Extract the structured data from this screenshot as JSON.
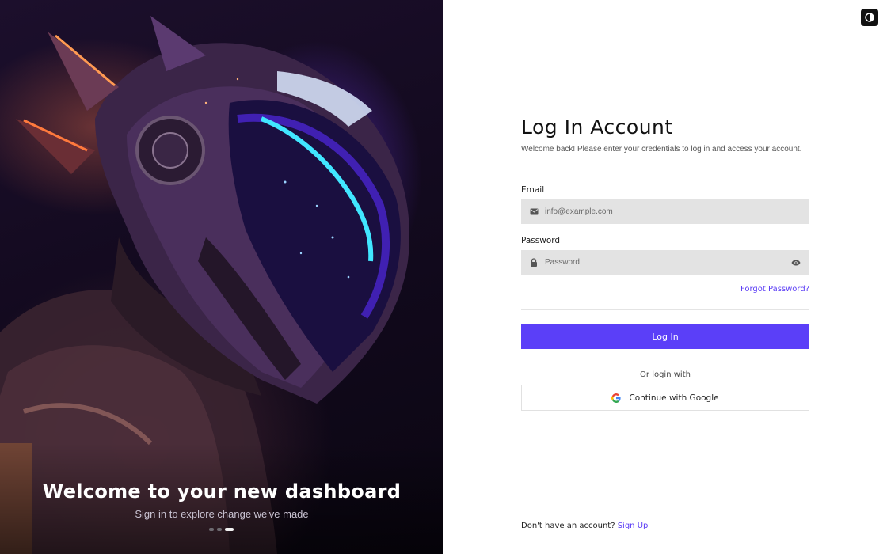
{
  "hero": {
    "image_alt": "Futuristic armored rider in a neon purple helmet",
    "title": "Welcome to your new dashboard",
    "subtitle": "Sign in to explore change we've made",
    "carousel": {
      "count": 3,
      "active_index": 2
    }
  },
  "theme_toggle": {
    "icon": "contrast-icon"
  },
  "form": {
    "title": "Log In Account",
    "subtitle": "Welcome back! Please enter your credentials to log in and access your account.",
    "email_label": "Email",
    "email_placeholder": "info@example.com",
    "email_value": "",
    "password_label": "Password",
    "password_placeholder": "Password",
    "password_value": "",
    "forgot_label": "Forgot Password?",
    "login_label": "Log In",
    "or_label": "Or login with",
    "google_label": "Continue with Google"
  },
  "signup": {
    "prompt": "Don't have an account?",
    "link_label": "Sign Up"
  },
  "colors": {
    "accent": "#5b3ff8",
    "link": "#5b3df5",
    "field_bg": "#e3e3e3",
    "hero_bg": "#130a1f"
  }
}
